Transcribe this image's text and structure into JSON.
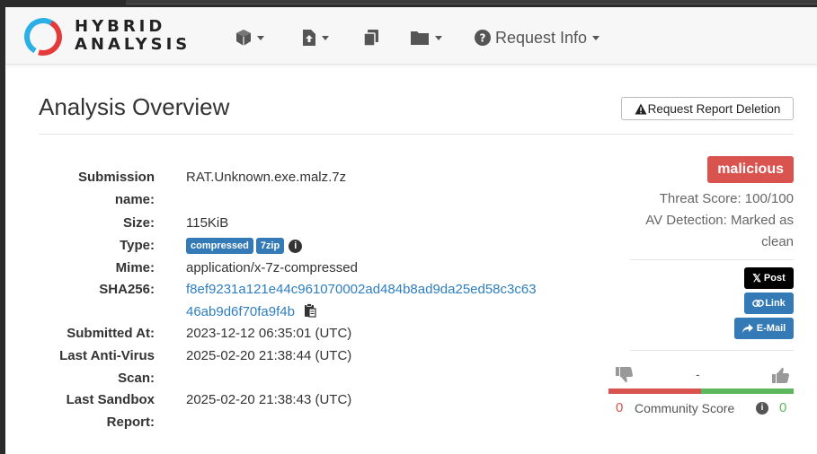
{
  "header": {
    "logo_line1": "HYBRID",
    "logo_line2": "ANALYSIS",
    "nav": [
      {
        "icon": "cube-icon"
      },
      {
        "icon": "file-upload-icon"
      },
      {
        "icon": "copy-icon"
      },
      {
        "icon": "folder-icon"
      },
      {
        "icon": "question-circle-icon",
        "label": "Request Info"
      }
    ]
  },
  "overview": {
    "title": "Analysis Overview",
    "delete_button": "Request Report Deletion",
    "fields": {
      "submission_name_label_1": "Submission",
      "submission_name_label_2": "name:",
      "submission_name": "RAT.Unknown.exe.malz.7z",
      "size_label": "Size:",
      "size": "115KiB",
      "type_label": "Type:",
      "type_tags": [
        "compressed",
        "7zip"
      ],
      "mime_label": "Mime:",
      "mime": "application/x-7z-compressed",
      "sha256_label": "SHA256:",
      "sha256_line1": "f8ef9231a121e44c961070002ad484b8ad9da25ed58c3c63",
      "sha256_line2": "46ab9d6f70fa9f4b",
      "submitted_label": "Submitted At:",
      "submitted": "2023-12-12 06:35:01 (UTC)",
      "last_av_label_1": "Last Anti-Virus",
      "last_av_label_2": "Scan:",
      "last_av": "2025-02-20 21:38:44 (UTC)",
      "last_sandbox_label_1": "Last Sandbox",
      "last_sandbox_label_2": "Report:",
      "last_sandbox": "2025-02-20 21:38:43 (UTC)"
    }
  },
  "verdict": {
    "label": "malicious",
    "threat_score": "Threat Score: 100/100",
    "av_line1": "AV Detection: Marked as",
    "av_line2": "clean"
  },
  "share": {
    "x_post": "Post",
    "link": "Link",
    "email": "E-Mail"
  },
  "community": {
    "separator": "-",
    "down_count": "0",
    "label": "Community Score",
    "up_count": "0",
    "negative_fraction": 0.5,
    "colors": {
      "negative": "#d9534f",
      "positive": "#5cb85c"
    }
  }
}
